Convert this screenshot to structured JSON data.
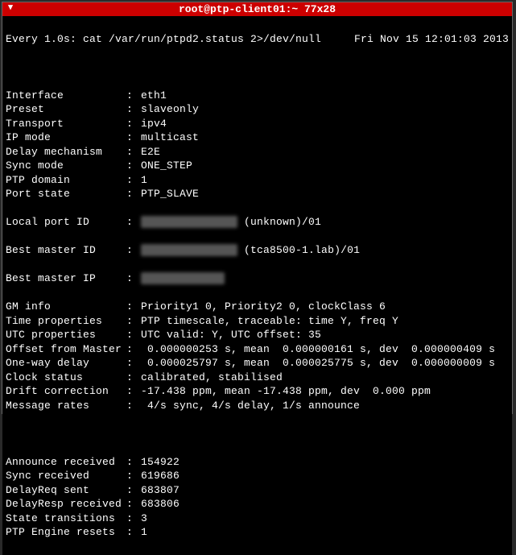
{
  "titlebar": {
    "title": "root@ptp-client01:~ 77x28"
  },
  "header": {
    "left": "Every 1.0s: cat /var/run/ptpd2.status 2>/dev/null",
    "right": "Fri Nov 15 12:01:03 2013"
  },
  "rows": [
    {
      "label": "Interface",
      "value": "eth1"
    },
    {
      "label": "Preset",
      "value": "slaveonly"
    },
    {
      "label": "Transport",
      "value": "ipv4"
    },
    {
      "label": "IP mode",
      "value": "multicast"
    },
    {
      "label": "Delay mechanism",
      "value": "E2E"
    },
    {
      "label": "Sync mode",
      "value": "ONE_STEP"
    },
    {
      "label": "PTP domain",
      "value": "1"
    },
    {
      "label": "Port state",
      "value": "PTP_SLAVE"
    }
  ],
  "localPort": {
    "label": "Local port ID",
    "redacted": "XXXXXXXXXXXXXXX",
    "suffix": "(unknown)/01"
  },
  "bestMasterId": {
    "label": "Best master ID",
    "redacted": "XXXXXXXXXXXXXXX",
    "suffix": "(tca8500-1.lab)/01"
  },
  "bestMasterIp": {
    "label": "Best master IP",
    "redacted": "XXX.XX.XXX.XX"
  },
  "rows2": [
    {
      "label": "GM info",
      "value": "Priority1 0, Priority2 0, clockClass 6"
    },
    {
      "label": "Time properties",
      "value": "PTP timescale, traceable: time Y, freq Y"
    },
    {
      "label": "UTC properties",
      "value": "UTC valid: Y, UTC offset: 35"
    },
    {
      "label": "Offset from Master",
      "value": " 0.000000253 s, mean  0.000000161 s, dev  0.000000409 s"
    },
    {
      "label": "One-way delay",
      "value": " 0.000025797 s, mean  0.000025775 s, dev  0.000000009 s"
    },
    {
      "label": "Clock status",
      "value": "calibrated, stabilised"
    },
    {
      "label": "Drift correction",
      "value": "-17.438 ppm, mean -17.438 ppm, dev  0.000 ppm"
    },
    {
      "label": "Message rates",
      "value": " 4/s sync, 4/s delay, 1/s announce"
    }
  ],
  "rows3": [
    {
      "label": "Announce received",
      "value": "154922"
    },
    {
      "label": "Sync received",
      "value": "619686"
    },
    {
      "label": "DelayReq sent",
      "value": "683807"
    },
    {
      "label": "DelayResp received",
      "value": "683806"
    },
    {
      "label": "State transitions",
      "value": "3"
    },
    {
      "label": "PTP Engine resets",
      "value": "1"
    }
  ]
}
